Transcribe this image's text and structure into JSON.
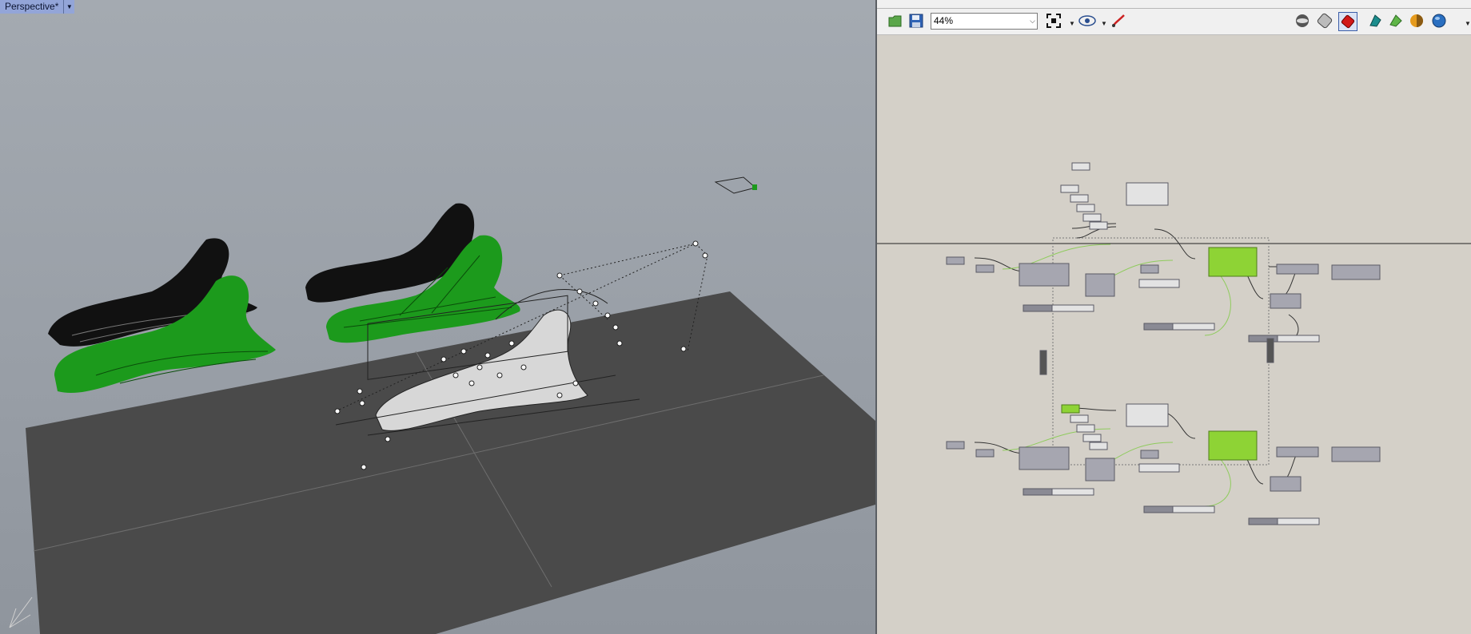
{
  "viewport": {
    "title": "Perspective*",
    "menu_icon": "triangle-down-icon",
    "colors": {
      "background": "#9aa1a8",
      "ground": "#4a4a4a",
      "green": "#1c9a1c",
      "black": "#111111"
    },
    "axis_icon": "world-axes-icon"
  },
  "grasshopper": {
    "toolbar": {
      "zoom_value": "44%",
      "icons": [
        "open-file-icon",
        "save-file-icon",
        "zoom-extents-icon",
        "preview-eye-icon",
        "sketch-pen-icon",
        "preview-wire-icon",
        "preview-shaded-icon",
        "preview-selected-icon",
        "bake-icon",
        "display-mesh-icon",
        "material-icon",
        "sphere-icon"
      ]
    },
    "colors": {
      "canvas": "#d4d0c8",
      "component": "#a6a6b0",
      "selected_component": "#8ed335",
      "wire_green": "#8fcb5d"
    }
  }
}
